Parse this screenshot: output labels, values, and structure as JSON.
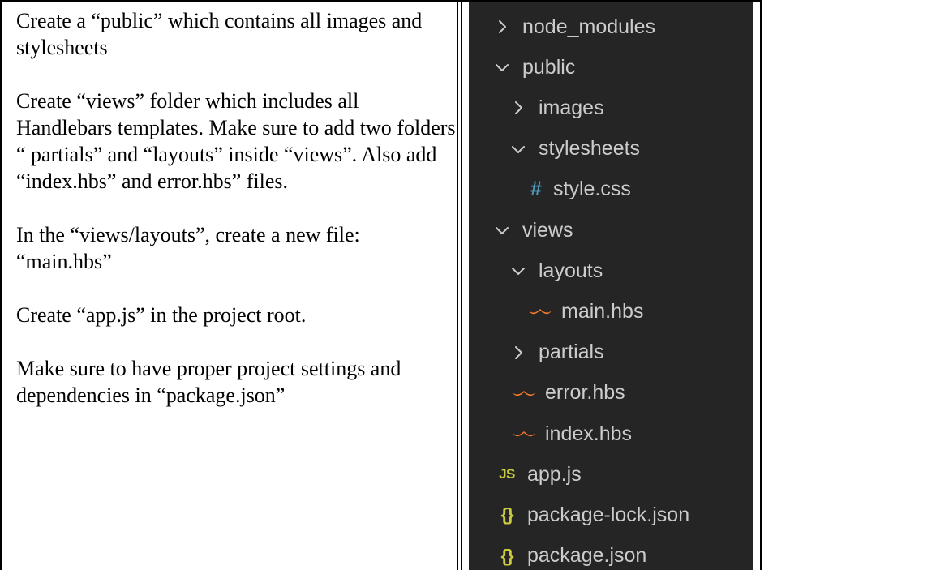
{
  "instructions": [
    "Create a “public” which contains all images and stylesheets",
    "Create “views” folder which includes all Handlebars templates. Make sure to add two folders “ partials” and “layouts” inside “views”. Also add “index.hbs” and error.hbs” files.",
    "In the “views/layouts”, create a new file: “main.hbs”",
    "Create “app.js” in the project root.",
    "Make sure to have proper project settings and dependencies in “package.json”"
  ],
  "explorer": {
    "items": [
      {
        "label": "node_modules",
        "type": "folder",
        "expanded": false,
        "depth": 0
      },
      {
        "label": "public",
        "type": "folder",
        "expanded": true,
        "depth": 0
      },
      {
        "label": "images",
        "type": "folder",
        "expanded": false,
        "depth": 1
      },
      {
        "label": "stylesheets",
        "type": "folder",
        "expanded": true,
        "depth": 1
      },
      {
        "label": "style.css",
        "type": "file",
        "icon": "css-hash-icon",
        "depth": 2
      },
      {
        "label": "views",
        "type": "folder",
        "expanded": true,
        "depth": 0
      },
      {
        "label": "layouts",
        "type": "folder",
        "expanded": true,
        "depth": 1
      },
      {
        "label": "main.hbs",
        "type": "file",
        "icon": "handlebars-icon",
        "depth": 2
      },
      {
        "label": "partials",
        "type": "folder",
        "expanded": false,
        "depth": 1
      },
      {
        "label": "error.hbs",
        "type": "file",
        "icon": "handlebars-icon",
        "depth": 1
      },
      {
        "label": "index.hbs",
        "type": "file",
        "icon": "handlebars-icon",
        "depth": 1
      },
      {
        "label": "app.js",
        "type": "file",
        "icon": "js-icon",
        "icon_text": "JS",
        "depth": 0
      },
      {
        "label": "package-lock.json",
        "type": "file",
        "icon": "json-icon",
        "icon_text": "{}",
        "depth": 0
      },
      {
        "label": "package.json",
        "type": "file",
        "icon": "json-icon",
        "icon_text": "{}",
        "depth": 0
      }
    ]
  },
  "colors": {
    "explorer_bg": "#252526",
    "explorer_text": "#cccccc",
    "css_icon": "#519aba",
    "handlebars_icon": "#f0772b",
    "js_json_icon": "#cbcb41"
  }
}
